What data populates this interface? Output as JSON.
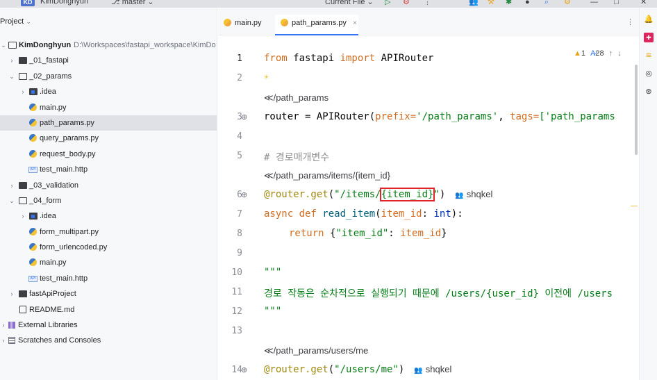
{
  "titlebar": {
    "avatar": "KD",
    "project": "KimDonghyun",
    "branch": "master",
    "run_config": "Current File",
    "icons": [
      "people-icon",
      "hammer-icon",
      "bug-icon",
      "stop-icon",
      "search-icon",
      "settings-icon",
      "minimize-icon",
      "maximize-icon",
      "close-icon"
    ]
  },
  "project_panel": {
    "title": "Project",
    "root_name": "KimDonghyun",
    "root_path": "D:\\Workspaces\\fastapi_workspace\\KimDo",
    "items": [
      {
        "label": "_01_fastapi",
        "type": "folder",
        "expanded": false
      },
      {
        "label": "_02_params",
        "type": "folder",
        "expanded": true
      },
      {
        "label": ".idea",
        "type": "idea-folder",
        "expanded": false
      },
      {
        "label": "main.py",
        "type": "py"
      },
      {
        "label": "path_params.py",
        "type": "py",
        "selected": true
      },
      {
        "label": "query_params.py",
        "type": "py"
      },
      {
        "label": "request_body.py",
        "type": "py"
      },
      {
        "label": "test_main.http",
        "type": "http"
      },
      {
        "label": "_03_validation",
        "type": "folder",
        "expanded": false
      },
      {
        "label": "_04_form",
        "type": "folder",
        "expanded": true
      },
      {
        "label": ".idea",
        "type": "idea-folder",
        "expanded": false
      },
      {
        "label": "form_multipart.py",
        "type": "py"
      },
      {
        "label": "form_urlencoded.py",
        "type": "py"
      },
      {
        "label": "main.py",
        "type": "py"
      },
      {
        "label": "test_main.http",
        "type": "http"
      },
      {
        "label": "fastApiProject",
        "type": "folder",
        "expanded": false
      },
      {
        "label": "README.md",
        "type": "md"
      },
      {
        "label": "External Libraries",
        "type": "lib"
      },
      {
        "label": "Scratches and Consoles",
        "type": "scratch"
      }
    ]
  },
  "tabs": [
    {
      "label": "main.py",
      "active": false
    },
    {
      "label": "path_params.py",
      "active": true,
      "close": "×"
    }
  ],
  "inspections": {
    "warnings": "1",
    "typos": "28"
  },
  "editor": {
    "line_numbers": [
      "1",
      "2",
      "3",
      "4",
      "5",
      "6",
      "7",
      "8",
      "9",
      "10",
      "11",
      "12",
      "13",
      "14"
    ],
    "hints": {
      "route1": "/path_params",
      "route2": "/path_params/items/{item_id}",
      "route3": "/path_params/users/me"
    },
    "author": "shqkel",
    "code": {
      "l1_from": "from",
      "l1_mod": " fastapi ",
      "l1_import": "import",
      "l1_name": " APIRouter",
      "l3_a": "router = APIRouter(",
      "l3_prefix_kw": "prefix=",
      "l3_prefix_val": "'/path_params'",
      "l3_comma": ", ",
      "l3_tags_kw": "tags=",
      "l3_tags_val": "['path_params",
      "l5_comment": "# 경로매개변수",
      "l6_dec": "@router.get",
      "l6_open": "(",
      "l6_str_a": "\"/items/",
      "l6_str_hl": "{item_id}",
      "l6_str_b": "\"",
      "l6_close": ")",
      "l7_async": "async def ",
      "l7_fn": "read_item",
      "l7_open": "(",
      "l7_param": "item_id",
      "l7_colon": ": ",
      "l7_type": "int",
      "l7_close": "):",
      "l8_return": "return",
      "l8_open": " {",
      "l8_key": "\"item_id\"",
      "l8_colon": ": ",
      "l8_val": "item_id",
      "l8_close": "}",
      "l10": "\"\"\"",
      "l11_a": "경로 작동은 순차적으로 실행되기 때문에 ",
      "l11_b": "/users/{user_id}",
      "l11_c": " 이전에 /users",
      "l12": "\"\"\"",
      "l14_dec": "@router.get",
      "l14_open": "(",
      "l14_str": "\"/users/me\"",
      "l14_close": ")"
    }
  },
  "colors": {
    "accent": "#3574f0",
    "highlight_box": "#e0242a",
    "keyword": "#cf6c21",
    "string": "#067d17"
  }
}
